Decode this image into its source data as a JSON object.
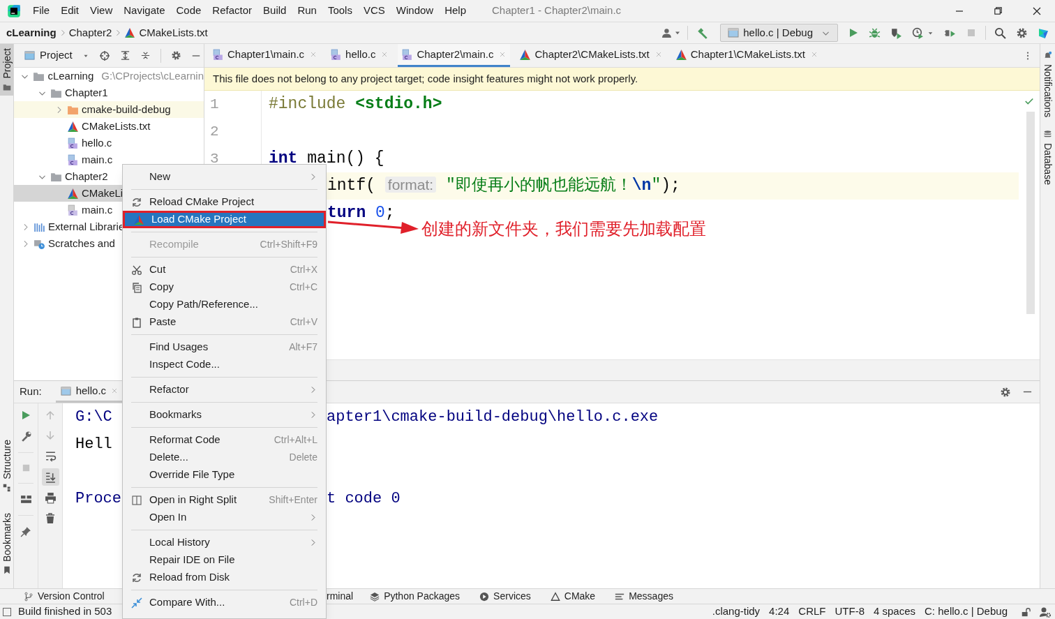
{
  "title_bar": {
    "menus": [
      "File",
      "Edit",
      "View",
      "Navigate",
      "Code",
      "Refactor",
      "Build",
      "Run",
      "Tools",
      "VCS",
      "Window",
      "Help"
    ],
    "title": "Chapter1 - Chapter2\\main.c"
  },
  "breadcrumbs": [
    {
      "label": "cLearning",
      "kind": "project"
    },
    {
      "label": "Chapter2",
      "kind": "folder"
    },
    {
      "label": "CMakeLists.txt",
      "kind": "cmake"
    }
  ],
  "toolbar": {
    "run_config": "hello.c | Debug"
  },
  "left_strip": [
    {
      "label": "Project",
      "selected": true,
      "kind": "project"
    },
    {
      "label": "Structure",
      "selected": false,
      "kind": "structure"
    },
    {
      "label": "Bookmarks",
      "selected": false,
      "kind": "bookmarks"
    }
  ],
  "right_strip": [
    {
      "label": "Notifications",
      "kind": "notifications"
    },
    {
      "label": "Database",
      "kind": "database"
    }
  ],
  "project_panel": {
    "title": "Project",
    "tree": [
      {
        "label": "cLearning",
        "hint": "G:\\CProjects\\cLearnin",
        "kind": "folder",
        "expanded": true,
        "selected": false,
        "highlighted": false,
        "children": [
          {
            "label": "Chapter1",
            "kind": "folder",
            "expanded": true,
            "selected": false,
            "highlighted": false,
            "children": [
              {
                "label": "cmake-build-debug",
                "kind": "excluded",
                "expanded": false,
                "selected": false,
                "highlighted": true
              },
              {
                "label": "CMakeLists.txt",
                "kind": "cmake",
                "selected": false,
                "highlighted": false
              },
              {
                "label": "hello.c",
                "kind": "c",
                "selected": false,
                "highlighted": false
              },
              {
                "label": "main.c",
                "kind": "c",
                "selected": false,
                "highlighted": false
              }
            ]
          },
          {
            "label": "Chapter2",
            "kind": "folder",
            "expanded": true,
            "selected": false,
            "highlighted": false,
            "children": [
              {
                "label": "CMakeLi",
                "kind": "cmake",
                "selected": true,
                "highlighted": false
              },
              {
                "label": "main.c",
                "kind": "c-gray",
                "selected": false,
                "highlighted": false
              }
            ]
          }
        ]
      },
      {
        "label": "External Librarie",
        "kind": "library",
        "expanded": false,
        "selected": false,
        "highlighted": false
      },
      {
        "label": "Scratches and",
        "kind": "scratches",
        "expanded": false,
        "selected": false,
        "highlighted": false
      }
    ]
  },
  "editor": {
    "tabs": [
      {
        "label": "Chapter1\\main.c",
        "kind": "c",
        "selected": false
      },
      {
        "label": "hello.c",
        "kind": "c",
        "selected": false
      },
      {
        "label": "Chapter2\\main.c",
        "kind": "c",
        "selected": true
      },
      {
        "label": "Chapter2\\CMakeLists.txt",
        "kind": "cmake",
        "selected": false
      },
      {
        "label": "Chapter1\\CMakeLists.txt",
        "kind": "cmake",
        "selected": false
      }
    ],
    "banner": "This file does not belong to any project target; code insight features might not work properly.",
    "lines": [
      {
        "number": "1",
        "clipped": false,
        "current": false,
        "segments": [
          {
            "kind": "directive",
            "text": "#include"
          },
          {
            "kind": "header",
            "text": " <stdio.h>"
          }
        ]
      },
      {
        "number": "2"
      },
      {
        "number": "3",
        "clipped": false,
        "current": false,
        "segments": [
          {
            "kind": "keyword",
            "text": "int"
          },
          {
            "kind": "plain",
            "text": " main() {"
          }
        ]
      },
      {
        "clipped": true,
        "current": true,
        "segments": [
          {
            "kind": "plain",
            "text": "intf( "
          },
          {
            "kind": "hint",
            "text": "format:"
          },
          {
            "kind": "string",
            "text": " \"即使再小的帆也能远航！"
          },
          {
            "kind": "escape",
            "text": "\\n"
          },
          {
            "kind": "string",
            "text": "\""
          },
          {
            "kind": "plain",
            "text": ");"
          }
        ]
      },
      {
        "clipped": true,
        "current": false,
        "segments": [
          {
            "kind": "keyword",
            "text": "turn"
          },
          {
            "kind": "number",
            "text": " 0"
          },
          {
            "kind": "plain",
            "text": ";"
          }
        ]
      }
    ]
  },
  "context_menu": {
    "items": [
      {
        "kind": "submenu",
        "label": "New",
        "selected": false,
        "disabled": false
      },
      {
        "kind": "separator"
      },
      {
        "kind": "command",
        "label": "Reload CMake Project",
        "selected": false,
        "disabled": false
      },
      {
        "kind": "command",
        "label": "Load CMake Project",
        "selected": true,
        "disabled": false,
        "outlined": true
      },
      {
        "kind": "separator"
      },
      {
        "kind": "command",
        "label": "Recompile",
        "shortcut": "Ctrl+Shift+F9",
        "selected": false,
        "disabled": true
      },
      {
        "kind": "separator"
      },
      {
        "kind": "command",
        "label": "Cut",
        "shortcut": "Ctrl+X",
        "selected": false,
        "disabled": false
      },
      {
        "kind": "command",
        "label": "Copy",
        "shortcut": "Ctrl+C",
        "selected": false,
        "disabled": false
      },
      {
        "kind": "command",
        "label": "Copy Path/Reference...",
        "selected": false,
        "disabled": false
      },
      {
        "kind": "command",
        "label": "Paste",
        "shortcut": "Ctrl+V",
        "selected": false,
        "disabled": false
      },
      {
        "kind": "separator"
      },
      {
        "kind": "command",
        "label": "Find Usages",
        "shortcut": "Alt+F7",
        "selected": false,
        "disabled": false
      },
      {
        "kind": "command",
        "label": "Inspect Code...",
        "selected": false,
        "disabled": false
      },
      {
        "kind": "separator"
      },
      {
        "kind": "submenu",
        "label": "Refactor",
        "selected": false,
        "disabled": false
      },
      {
        "kind": "separator"
      },
      {
        "kind": "submenu",
        "label": "Bookmarks",
        "selected": false,
        "disabled": false
      },
      {
        "kind": "separator"
      },
      {
        "kind": "command",
        "label": "Reformat Code",
        "shortcut": "Ctrl+Alt+L",
        "selected": false,
        "disabled": false
      },
      {
        "kind": "command",
        "label": "Delete...",
        "shortcut": "Delete",
        "selected": false,
        "disabled": false
      },
      {
        "kind": "command",
        "label": "Override File Type",
        "selected": false,
        "disabled": false
      },
      {
        "kind": "separator"
      },
      {
        "kind": "command",
        "label": "Open in Right Split",
        "shortcut": "Shift+Enter",
        "selected": false,
        "disabled": false
      },
      {
        "kind": "submenu",
        "label": "Open In",
        "selected": false,
        "disabled": false
      },
      {
        "kind": "separator"
      },
      {
        "kind": "submenu",
        "label": "Local History",
        "selected": false,
        "disabled": false
      },
      {
        "kind": "command",
        "label": "Repair IDE on File",
        "selected": false,
        "disabled": false
      },
      {
        "kind": "command",
        "label": "Reload from Disk",
        "selected": false,
        "disabled": false
      },
      {
        "kind": "separator"
      },
      {
        "kind": "command",
        "label": "Compare With...",
        "shortcut": "Ctrl+D",
        "selected": false,
        "disabled": false
      }
    ]
  },
  "annotation": {
    "text": "创建的新文件夹，我们需要先加载配置"
  },
  "run_panel": {
    "label": "Run:",
    "tab": "hello.c",
    "output": [
      {
        "kind": "system",
        "left": "G:\\C",
        "right": "apter1\\cmake-build-debug\\hello.c.exe"
      },
      {
        "kind": "stdout",
        "left": "Hell"
      },
      {
        "kind": "blank"
      },
      {
        "kind": "system",
        "left": "Proce",
        "right": "t code 0"
      }
    ]
  },
  "tool_windows": [
    {
      "label": "Version Control",
      "kind": "vcs"
    },
    {
      "label": "rminal",
      "kind": "clipped"
    },
    {
      "label": "Python Packages",
      "kind": "packages"
    },
    {
      "label": "Services",
      "kind": "services"
    },
    {
      "label": "CMake",
      "kind": "cmake"
    },
    {
      "label": "Messages",
      "kind": "messages"
    }
  ],
  "status_bar": {
    "message": "Build finished in 503",
    "items": [
      ".clang-tidy",
      "4:24",
      "CRLF",
      "UTF-8",
      "4 spaces",
      "C: hello.c | Debug"
    ]
  }
}
